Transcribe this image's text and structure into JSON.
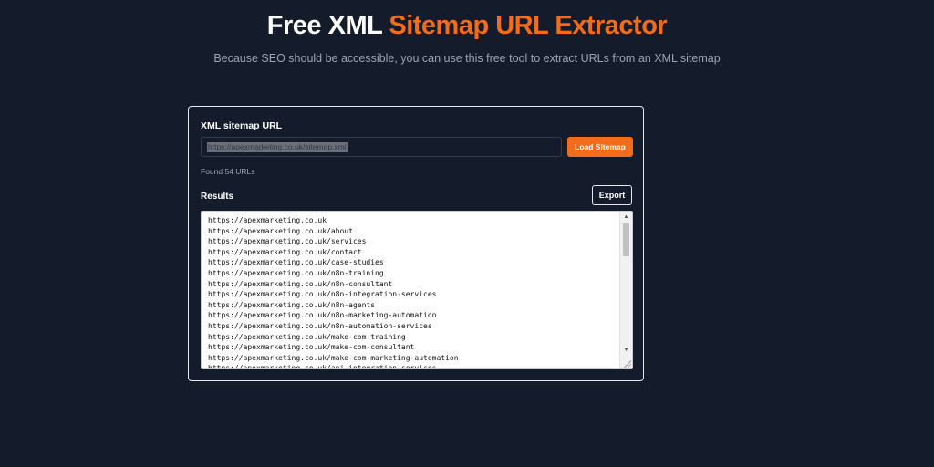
{
  "header": {
    "title_plain": "Free XML ",
    "title_accent": "Sitemap URL Extractor",
    "subtitle": "Because SEO should be accessible, you can use this free tool to extract URLs from an XML sitemap"
  },
  "form": {
    "label": "XML sitemap URL",
    "input_value": "https://apexmarketing.co.uk/sitemap.xml",
    "load_button": "Load Sitemap",
    "status": "Found 54 URLs"
  },
  "results": {
    "label": "Results",
    "export_button": "Export",
    "urls": [
      "https://apexmarketing.co.uk",
      "https://apexmarketing.co.uk/about",
      "https://apexmarketing.co.uk/services",
      "https://apexmarketing.co.uk/contact",
      "https://apexmarketing.co.uk/case-studies",
      "https://apexmarketing.co.uk/n8n-training",
      "https://apexmarketing.co.uk/n8n-consultant",
      "https://apexmarketing.co.uk/n8n-integration-services",
      "https://apexmarketing.co.uk/n8n-agents",
      "https://apexmarketing.co.uk/n8n-marketing-automation",
      "https://apexmarketing.co.uk/n8n-automation-services",
      "https://apexmarketing.co.uk/make-com-training",
      "https://apexmarketing.co.uk/make-com-consultant",
      "https://apexmarketing.co.uk/make-com-marketing-automation",
      "https://apexmarketing.co.uk/api-integration-services"
    ]
  },
  "icons": {
    "scroll_up": "scroll-up-arrow-icon",
    "scroll_down": "scroll-down-arrow-icon",
    "resize": "resize-grip-icon"
  },
  "colors": {
    "background": "#141c2b",
    "accent": "#f36c1b",
    "muted_text": "#9aa4b4"
  }
}
